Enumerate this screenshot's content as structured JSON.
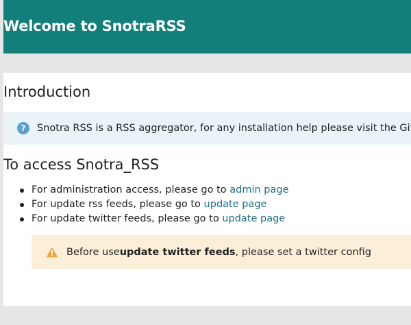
{
  "header": {
    "title": "Welcome to SnotraRSS"
  },
  "intro": {
    "heading": "Introduction",
    "info_icon": "question-circle-icon",
    "info_text": "Snotra RSS is a RSS aggregator, for any installation help please visit the GitHub pa"
  },
  "access": {
    "heading": "To access Snotra_RSS",
    "items": [
      {
        "prefix": "For administration access, please go to ",
        "link": "admin page"
      },
      {
        "prefix": "For update rss feeds, please go to ",
        "link": "update page"
      },
      {
        "prefix": "For update twitter feeds, please go to ",
        "link": "update page"
      }
    ]
  },
  "warning": {
    "icon": "warning-triangle-icon",
    "text_before": "Before use ",
    "text_bold": "update twitter feeds",
    "text_after": ", please set a twitter config"
  },
  "colors": {
    "header_bg": "#127f7b",
    "info_bg": "#eaf3f8",
    "warning_bg": "#fcefd9",
    "link": "#1b6e86",
    "warning_icon": "#e8a33c"
  }
}
